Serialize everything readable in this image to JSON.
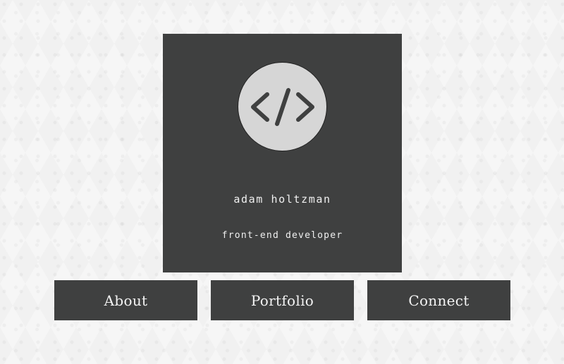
{
  "profile": {
    "name": "adam holtzman",
    "role": "front-end developer",
    "avatar_icon": "code-icon"
  },
  "nav": {
    "buttons": [
      {
        "label": "About"
      },
      {
        "label": "Portfolio"
      },
      {
        "label": "Connect"
      }
    ]
  },
  "colors": {
    "panel": "#3f4040",
    "avatar_bg": "#d6d6d6",
    "text": "#f0f0f0",
    "page_bg": "#f6f6f6"
  }
}
